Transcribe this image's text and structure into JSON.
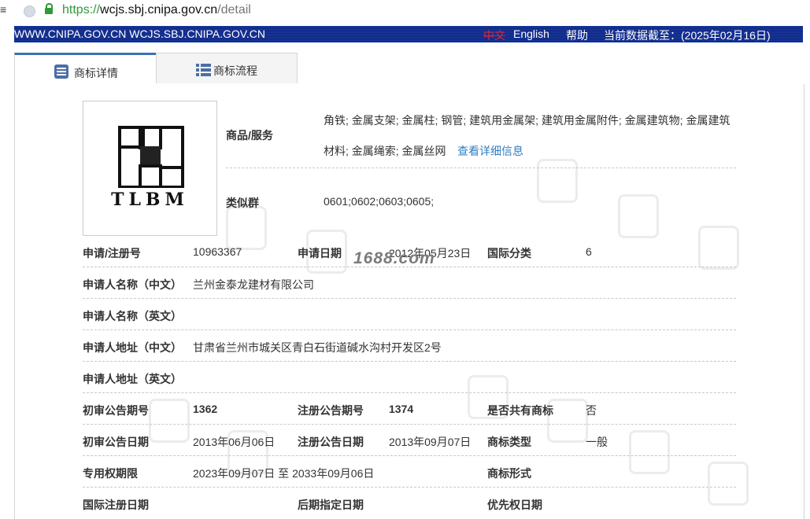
{
  "browser": {
    "url_proto": "https://",
    "url_host": "wcjs.sbj.cnipa.gov.cn",
    "url_path": "/detail"
  },
  "banner": {
    "site": "WWW.CNIPA.GOV.CN WCJS.SBJ.CNIPA.GOV.CN",
    "lang_zh": "中文",
    "lang_en": "English",
    "help": "帮助",
    "data_date": "当前数据截至：(2025年02月16日)"
  },
  "tabs": [
    {
      "label": "商标详情",
      "icon": "document-icon"
    },
    {
      "label": "商标流程",
      "icon": "list-icon"
    }
  ],
  "logo": {
    "text": "TLBM"
  },
  "goods": {
    "label": "商品/服务",
    "line1": "角铁; 金属支架; 金属柱; 钢管; 建筑用金属架; 建筑用金属附件; 金属建筑物; 金属建筑",
    "line2": "材料; 金属绳索; 金属丝网",
    "link": "查看详细信息"
  },
  "similar_group": {
    "label": "类似群",
    "value": "0601;0602;0603;0605;"
  },
  "watermark_stamp": "1688.com",
  "fields": {
    "reg_no_label": "申请/注册号",
    "reg_no": "10963367",
    "app_date_label": "申请日期",
    "app_date": "2012年05月23日",
    "intl_class_label": "国际分类",
    "intl_class": "6",
    "applicant_cn_label": "申请人名称（中文）",
    "applicant_cn": "兰州金泰龙建材有限公司",
    "applicant_en_label": "申请人名称（英文）",
    "applicant_en": "",
    "address_cn_label": "申请人地址（中文）",
    "address_cn": "甘肃省兰州市城关区青白石街道碱水沟村开发区2号",
    "address_en_label": "申请人地址（英文）",
    "address_en": "",
    "prelim_no_label": "初审公告期号",
    "prelim_no": "1362",
    "reg_pub_no_label": "注册公告期号",
    "reg_pub_no": "1374",
    "shared_label": "是否共有商标",
    "shared": "否",
    "prelim_date_label": "初审公告日期",
    "prelim_date": "2013年06月06日",
    "reg_pub_date_label": "注册公告日期",
    "reg_pub_date": "2013年09月07日",
    "tm_type_label": "商标类型",
    "tm_type": "一般",
    "term_label": "专用权期限",
    "term": "2023年09月07日 至 2033年09月06日",
    "tm_form_label": "商标形式",
    "intl_reg_date_label": "国际注册日期",
    "later_designation_label": "后期指定日期",
    "priority_date_label": "优先权日期"
  }
}
